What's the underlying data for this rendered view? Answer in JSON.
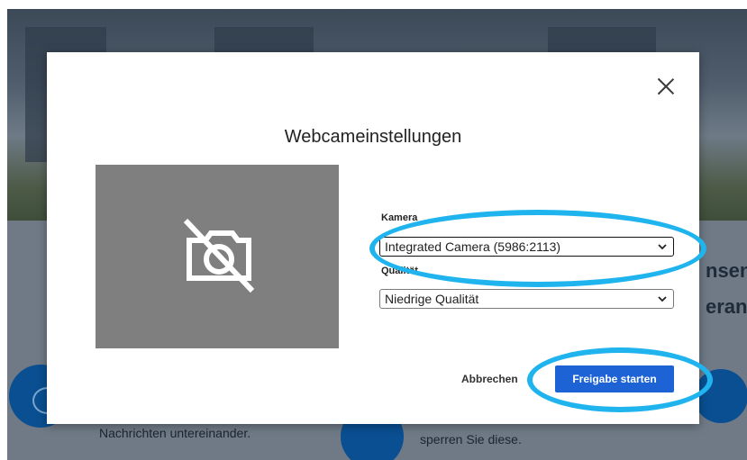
{
  "background": {
    "heading_fragment_1": "nsen",
    "heading_fragment_2": "erans",
    "caption_left": "Nachrichten untereinander.",
    "caption_mid": "sperren Sie diese."
  },
  "dialog": {
    "title": "Webcameinstellungen",
    "close_icon": "close-icon",
    "preview_icon": "camera-off-icon",
    "camera_label": "Kamera",
    "camera_value": "Integrated Camera (5986:2113)",
    "quality_label": "Qualität",
    "quality_value": "Niedrige Qualität",
    "cancel_label": "Abbrechen",
    "start_label": "Freigabe starten"
  },
  "colors": {
    "accent": "#1d63d6",
    "highlight": "#1fb4ee",
    "preview_bg": "#7f7f7f"
  }
}
